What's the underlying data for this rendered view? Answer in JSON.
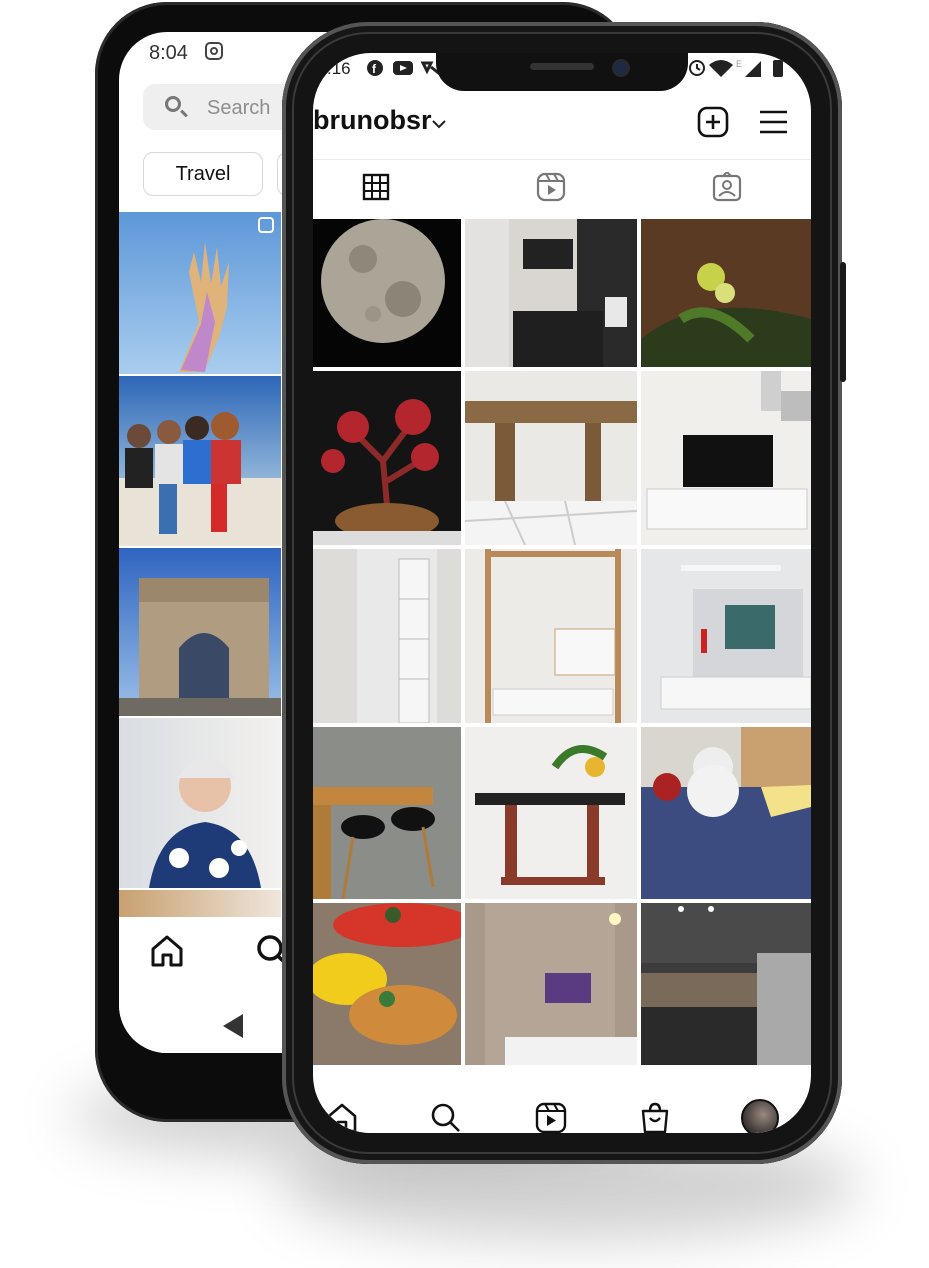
{
  "back_phone": {
    "status": {
      "time": "8:04"
    },
    "search": {
      "placeholder": "Search"
    },
    "chips": [
      "Travel"
    ]
  },
  "front_phone": {
    "status": {
      "time": ":16"
    },
    "profile": {
      "username": "brunobsr"
    }
  }
}
